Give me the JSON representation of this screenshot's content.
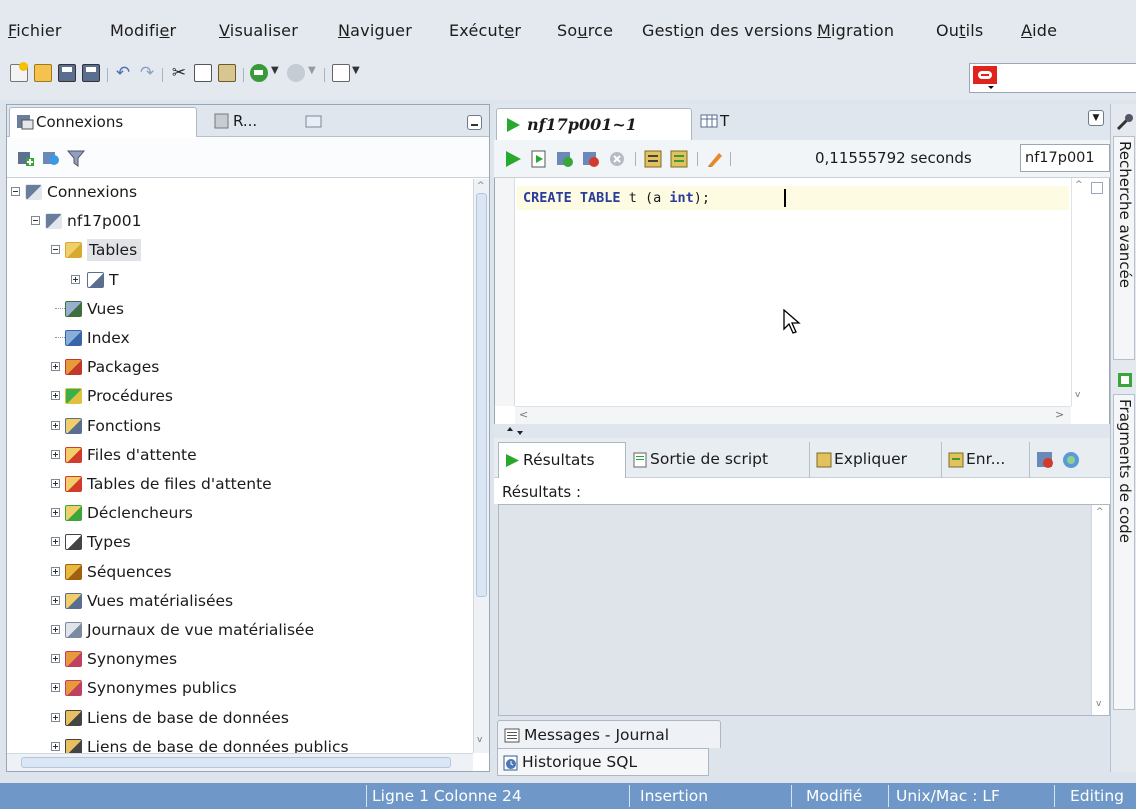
{
  "menu": {
    "items": [
      "Fichier",
      "Modifier",
      "Visualiser",
      "Naviguer",
      "Exécuter",
      "Source",
      "Gestion des versions",
      "Migration",
      "Outils",
      "Aide"
    ]
  },
  "left_panel": {
    "tabs": {
      "connections": "Connexions",
      "reports": "R..."
    },
    "tree": [
      {
        "label": "Connexions",
        "level": 0,
        "icon": "connections-icon"
      },
      {
        "label": "nf17p001",
        "level": 1,
        "icon": "database-connection-icon"
      },
      {
        "label": "Tables",
        "level": 2,
        "icon": "folder-icon",
        "selected": true
      },
      {
        "label": "T",
        "level": 3,
        "icon": "table-icon"
      },
      {
        "label": "Vues",
        "level": 2,
        "icon": "view-icon"
      },
      {
        "label": "Index",
        "level": 2,
        "icon": "index-icon"
      },
      {
        "label": "Packages",
        "level": 2,
        "icon": "package-icon"
      },
      {
        "label": "Procédures",
        "level": 2,
        "icon": "procedure-icon"
      },
      {
        "label": "Fonctions",
        "level": 2,
        "icon": "function-icon"
      },
      {
        "label": "Files d'attente",
        "level": 2,
        "icon": "queue-icon"
      },
      {
        "label": "Tables de files d'attente",
        "level": 2,
        "icon": "queue-table-icon"
      },
      {
        "label": "Déclencheurs",
        "level": 2,
        "icon": "trigger-icon"
      },
      {
        "label": "Types",
        "level": 2,
        "icon": "type-icon"
      },
      {
        "label": "Séquences",
        "level": 2,
        "icon": "sequence-icon"
      },
      {
        "label": "Vues matérialisées",
        "level": 2,
        "icon": "materialized-view-icon"
      },
      {
        "label": "Journaux de vue matérialisée",
        "level": 2,
        "icon": "materialized-view-log-icon"
      },
      {
        "label": "Synonymes",
        "level": 2,
        "icon": "synonym-icon"
      },
      {
        "label": "Synonymes publics",
        "level": 2,
        "icon": "public-synonym-icon"
      },
      {
        "label": "Liens de base de données",
        "level": 2,
        "icon": "db-link-icon"
      },
      {
        "label": "Liens de base de données publics",
        "level": 2,
        "icon": "public-db-link-icon"
      }
    ]
  },
  "editor": {
    "tabs": {
      "worksheet": "nf17p001~1",
      "table": "T"
    },
    "exec_time": "0,11555792 seconds",
    "connection": "nf17p001",
    "code": {
      "kw1": "CREATE",
      "kw2": "TABLE",
      "name": "t",
      "paren_open": "(",
      "col": "a",
      "kw3": "int",
      "tail": ");"
    }
  },
  "results": {
    "tabs": {
      "results": "Résultats",
      "script_output": "Sortie de script",
      "explain": "Expliquer",
      "autotrace": "Enr..."
    },
    "label": "Résultats :"
  },
  "bottom": {
    "messages": "Messages - Journal",
    "history": "Historique SQL"
  },
  "right_sidebar": {
    "search": "Recherche avancée",
    "snippets": "Fragments de code"
  },
  "status": {
    "position": "Ligne 1 Colonne 24",
    "mode": "Insertion",
    "modified": "Modifié",
    "line_ending": "Unix/Mac : LF",
    "editing": "Editing"
  },
  "colors": {
    "status_bar": "#6f98c8",
    "keyword": "#2a3c9e",
    "run_green": "#29a82e",
    "oracle_red": "#e1231b"
  }
}
